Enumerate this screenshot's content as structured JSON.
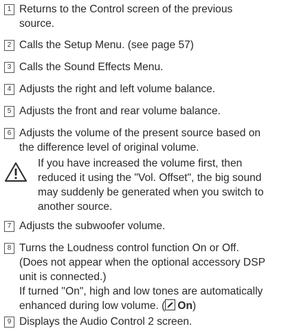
{
  "items": [
    {
      "num": "1",
      "lines": [
        "Returns to the Control screen of the previous",
        "source."
      ]
    },
    {
      "num": "2",
      "lines": [
        "Calls the Setup Menu. (see page 57)"
      ]
    },
    {
      "num": "3",
      "lines": [
        "Calls the Sound Effects Menu."
      ]
    },
    {
      "num": "4",
      "lines": [
        "Adjusts the right and left volume balance."
      ]
    },
    {
      "num": "5",
      "lines": [
        "Adjusts the front and rear volume balance."
      ]
    },
    {
      "num": "6",
      "lines": [
        "Adjusts the volume of the present source based on",
        "the difference level of original volume."
      ]
    }
  ],
  "warning": {
    "icon": "warning-triangle-icon",
    "lines": [
      "If you have increased the volume first, then",
      "reduced it using the \"Vol. Offset\", the big sound",
      "may suddenly be generated when you switch to",
      "another source."
    ]
  },
  "items2": [
    {
      "num": "7",
      "lines": [
        "Adjusts the subwoofer volume."
      ]
    },
    {
      "num": "8",
      "lines": [
        "Turns the Loudness control function On or Off.",
        "(Does not appear when the optional accessory DSP",
        "unit is connected.)",
        "If turned \"On\", high and low tones are automatically"
      ],
      "last_line_prefix": "enhanced during low volume. (",
      "default_value": "On",
      "last_line_suffix": ")"
    },
    {
      "num": "9",
      "lines": [
        "Displays the Audio Control 2 screen."
      ]
    }
  ]
}
